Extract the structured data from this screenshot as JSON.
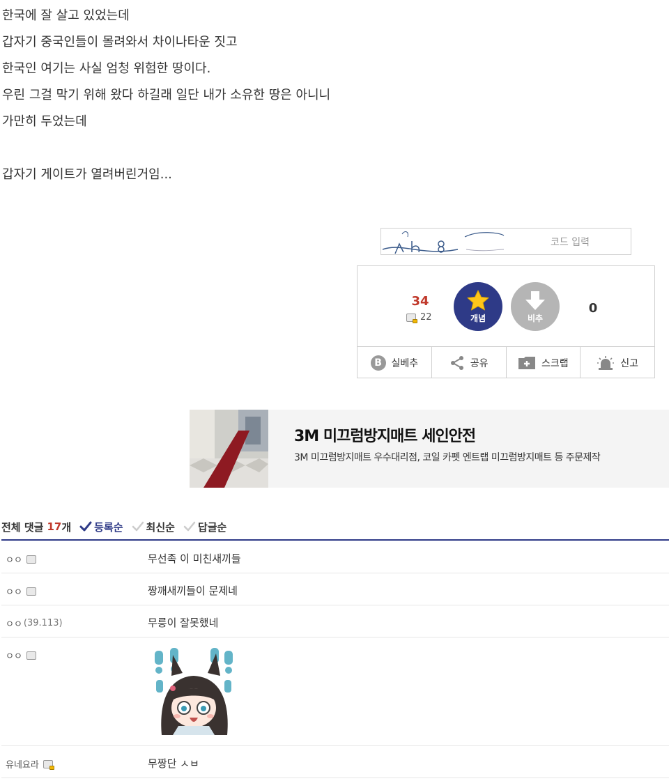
{
  "post": {
    "lines": [
      "한국에 잘 살고 있었는데",
      "갑자기 중국인들이 몰려와서 차이나타운 짓고",
      "한국인 여기는 사실 엄청 위험한 땅이다.",
      "우린 그걸 막기 위해 왔다 하길래 일단 내가 소유한 땅은 아니니",
      "가만히 두었는데",
      "",
      "갑자기 게이트가 열려버린거임..."
    ]
  },
  "captcha": {
    "placeholder": "코드 입력"
  },
  "vote": {
    "up_count": "34",
    "fixed_count": "22",
    "up_label": "개념",
    "down_label": "비추",
    "down_count": "0"
  },
  "actions": {
    "real_down": "실베추",
    "share": "공유",
    "scrap": "스크랩",
    "report": "신고"
  },
  "ad": {
    "title": "3M 미끄럼방지매트 세인안전",
    "desc": "3M 미끄럼방지매트 우수대리점, 코일 카펫 엔트랩 미끄럼방지매트 등 주문제작"
  },
  "comments_header": {
    "total_label": "전체 댓글",
    "count": "17",
    "unit": "개",
    "sort_register": "등록순",
    "sort_latest": "최신순",
    "sort_reply": "답글순"
  },
  "comments": [
    {
      "nick": "ㅇㅇ",
      "ip": "",
      "text": "무선족 이 미친새끼들"
    },
    {
      "nick": "ㅇㅇ",
      "ip": "",
      "text": "짱깨새끼들이 문제네"
    },
    {
      "nick": "ㅇㅇ",
      "ip": "(39.113)",
      "text": "무릉이 잘못했네"
    },
    {
      "nick": "ㅇㅇ",
      "ip": "",
      "text": ""
    },
    {
      "nick": "유네요라",
      "ip": "",
      "text": "무짱단 ㅅㅂ"
    }
  ],
  "colors": {
    "accent": "#2e3a87",
    "count_red": "#c0392b",
    "down_gray": "#b5b5b5"
  }
}
